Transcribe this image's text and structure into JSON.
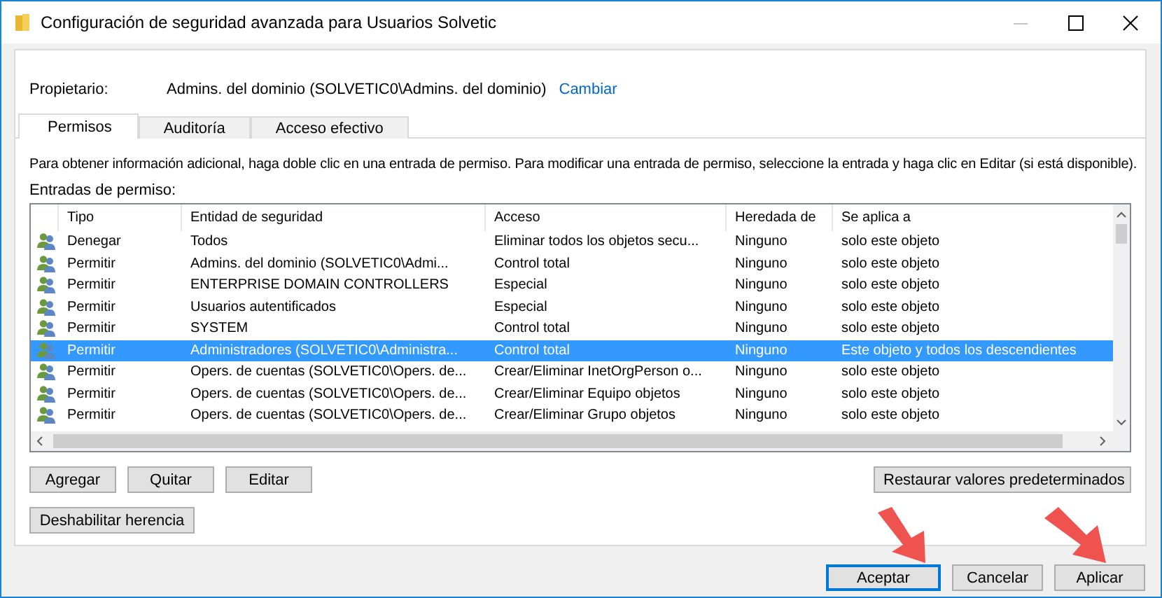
{
  "window": {
    "title": "Configuración de seguridad avanzada para Usuarios Solvetic"
  },
  "owner": {
    "label": "Propietario:",
    "value": "Admins. del dominio (SOLVETIC0\\Admins. del dominio)",
    "link": "Cambiar"
  },
  "tabs": [
    {
      "label": "Permisos",
      "selected": true
    },
    {
      "label": "Auditoría",
      "selected": false
    },
    {
      "label": "Acceso efectivo",
      "selected": false
    }
  ],
  "instructions": "Para obtener información adicional, haga doble clic en una entrada de permiso. Para modificar una entrada de permiso, seleccione la entrada y haga clic en Editar (si está disponible).",
  "entries_label": "Entradas de permiso:",
  "table": {
    "columns": [
      "Tipo",
      "Entidad de seguridad",
      "Acceso",
      "Heredada de",
      "Se aplica a"
    ],
    "rows": [
      {
        "cells": [
          "Denegar",
          "Todos",
          "Eliminar todos los objetos secu...",
          "Ninguno",
          "solo este objeto"
        ],
        "selected": false
      },
      {
        "cells": [
          "Permitir",
          "Admins. del dominio (SOLVETIC0\\Admi...",
          "Control total",
          "Ninguno",
          "solo este objeto"
        ],
        "selected": false
      },
      {
        "cells": [
          "Permitir",
          "ENTERPRISE DOMAIN CONTROLLERS",
          "Especial",
          "Ninguno",
          "solo este objeto"
        ],
        "selected": false
      },
      {
        "cells": [
          "Permitir",
          "Usuarios autentificados",
          "Especial",
          "Ninguno",
          "solo este objeto"
        ],
        "selected": false
      },
      {
        "cells": [
          "Permitir",
          "SYSTEM",
          "Control total",
          "Ninguno",
          "solo este objeto"
        ],
        "selected": false
      },
      {
        "cells": [
          "Permitir",
          "Administradores (SOLVETIC0\\Administra...",
          "Control total",
          "Ninguno",
          "Este objeto y todos los descendientes"
        ],
        "selected": true
      },
      {
        "cells": [
          "Permitir",
          "Opers. de cuentas (SOLVETIC0\\Opers. de...",
          "Crear/Eliminar InetOrgPerson o...",
          "Ninguno",
          "solo este objeto"
        ],
        "selected": false
      },
      {
        "cells": [
          "Permitir",
          "Opers. de cuentas (SOLVETIC0\\Opers. de...",
          "Crear/Eliminar Equipo objetos",
          "Ninguno",
          "solo este objeto"
        ],
        "selected": false
      },
      {
        "cells": [
          "Permitir",
          "Opers. de cuentas (SOLVETIC0\\Opers. de...",
          "Crear/Eliminar Grupo objetos",
          "Ninguno",
          "solo este objeto"
        ],
        "selected": false
      }
    ]
  },
  "entry_buttons": [
    "Agregar",
    "Quitar",
    "Editar"
  ],
  "restore_button": "Restaurar valores predeterminados",
  "inheritance_button": "Deshabilitar herencia",
  "dialog_buttons": [
    {
      "label": "Aceptar",
      "default": true
    },
    {
      "label": "Cancelar",
      "default": false
    },
    {
      "label": "Aplicar",
      "default": false
    }
  ]
}
